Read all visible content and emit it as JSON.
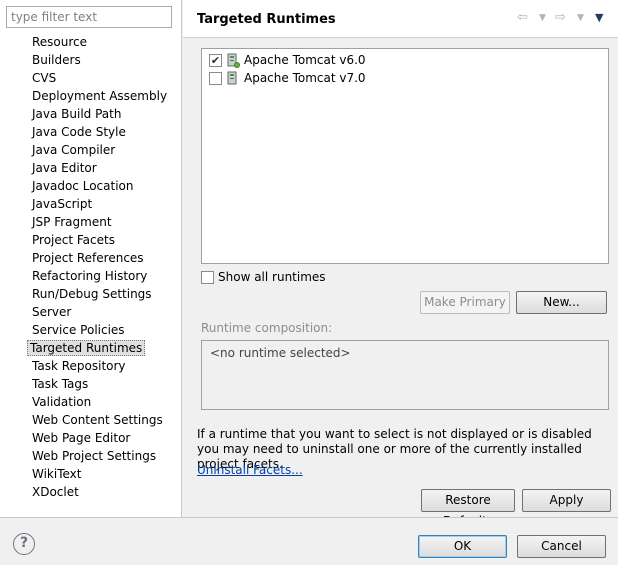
{
  "filter": {
    "placeholder": "type filter text"
  },
  "nav_items": [
    "Resource",
    "Builders",
    "CVS",
    "Deployment Assembly",
    "Java Build Path",
    "Java Code Style",
    "Java Compiler",
    "Java Editor",
    "Javadoc Location",
    "JavaScript",
    "JSP Fragment",
    "Project Facets",
    "Project References",
    "Refactoring History",
    "Run/Debug Settings",
    "Server",
    "Service Policies",
    "Targeted Runtimes",
    "Task Repository",
    "Task Tags",
    "Validation",
    "Web Content Settings",
    "Web Page Editor",
    "Web Project Settings",
    "WikiText",
    "XDoclet"
  ],
  "selected_nav": "Targeted Runtimes",
  "header": {
    "title": "Targeted Runtimes"
  },
  "runtimes": [
    {
      "label": "Apache Tomcat v6.0",
      "checked": true
    },
    {
      "label": "Apache Tomcat v7.0",
      "checked": false
    }
  ],
  "show_all": {
    "label": "Show all runtimes",
    "checked": false
  },
  "buttons": {
    "make_primary": "Make Primary",
    "new": "New...",
    "restore_defaults": "Restore Defaults",
    "apply": "Apply",
    "ok": "OK",
    "cancel": "Cancel"
  },
  "composition": {
    "label": "Runtime composition:",
    "value": "<no runtime selected>"
  },
  "info": {
    "text": "If a runtime that you want to select is not displayed or is disabled you may need to uninstall one or more of the currently installed project facets.",
    "link": "Uninstall Facets..."
  },
  "help": {
    "glyph": "?"
  },
  "icons": {
    "back": "back-arrow-icon",
    "forward": "forward-arrow-icon",
    "menu": "view-menu-icon",
    "server": "server-icon",
    "help": "help-icon"
  },
  "colors": {
    "link": "#003ea8",
    "selection": "#e0e0e0",
    "ok_border": "#3c7fb1"
  }
}
